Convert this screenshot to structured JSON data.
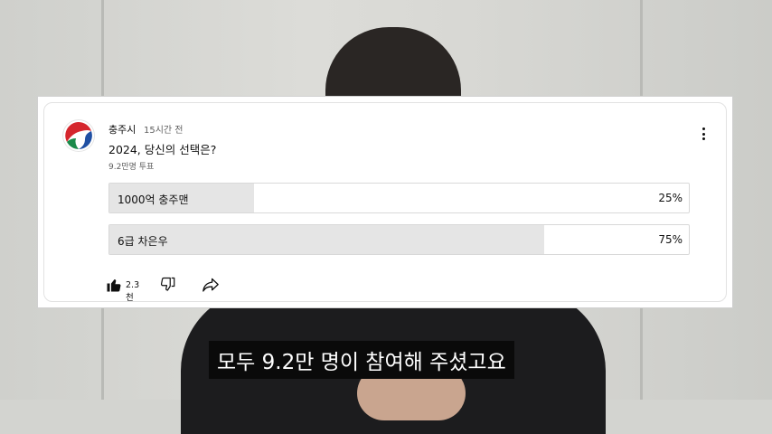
{
  "post": {
    "channel": "충주시",
    "time": "15시간 전",
    "question": "2024, 당신의 선택은?",
    "votes": "9.2만명 투표",
    "menu_icon": "more-vert-icon",
    "options": [
      {
        "label": "1000억 충주맨",
        "percent_text": "25%",
        "fraction": 0.25
      },
      {
        "label": "6급 차은우",
        "percent_text": "75%",
        "fraction": 0.75
      }
    ],
    "actions": {
      "like_count": "2.3천",
      "like_icon": "thumbs-up-icon",
      "dislike_icon": "thumbs-down-icon",
      "share_icon": "share-icon"
    }
  },
  "subtitle": "모두 9.2만 명이 참여해 주셨고요",
  "colors": {
    "logo_red": "#d5262d",
    "logo_green": "#1a8a4a",
    "logo_blue": "#1f4fa3",
    "bar_fill": "#e5e5e5"
  }
}
